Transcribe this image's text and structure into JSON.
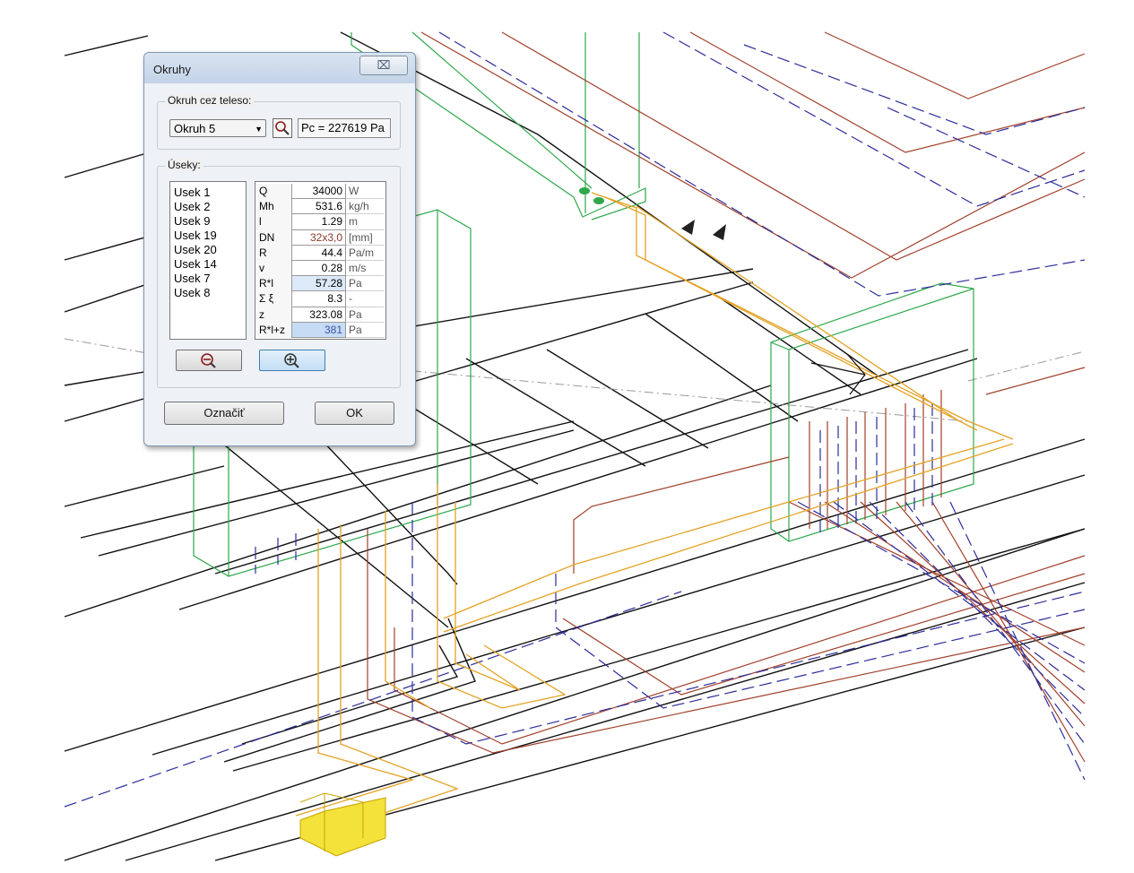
{
  "dialog": {
    "title": "Okruhy",
    "close_glyph": "⌧",
    "circuit_group_label": "Okruh cez teleso:",
    "circuit_selected": "Okruh 5",
    "pressure_text": "Pc = 227619 Pa",
    "sections_group_label": "Úseky:",
    "sections": [
      "Usek 1",
      "Usek 2",
      "Usek 9",
      "Usek 19",
      "Usek 20",
      "Usek 14",
      "Usek 7",
      "Usek 8"
    ],
    "properties": [
      {
        "name": "Q",
        "value": "34000",
        "unit": "W"
      },
      {
        "name": "Mh",
        "value": "531.6",
        "unit": "kg/h"
      },
      {
        "name": "l",
        "value": "1.29",
        "unit": "m"
      },
      {
        "name": "DN",
        "value": "32x3,0",
        "unit": "[mm]"
      },
      {
        "name": "R",
        "value": "44.4",
        "unit": "Pa/m"
      },
      {
        "name": "v",
        "value": "0.28",
        "unit": "m/s"
      },
      {
        "name": "R*l",
        "value": "57.28",
        "unit": "Pa"
      },
      {
        "name": "Σ ξ",
        "value": "8.3",
        "unit": "-"
      },
      {
        "name": "z",
        "value": "323.08",
        "unit": "Pa"
      },
      {
        "name": "R*l+z",
        "value": "381",
        "unit": "Pa"
      }
    ],
    "zoom_out_icon": "zoom-out-icon",
    "zoom_in_icon": "zoom-in-icon",
    "mark_button": "Označiť",
    "ok_button": "OK"
  },
  "colors": {
    "supply_pipe": "#a0402a",
    "return_pipe": "#2d2d9a",
    "distribution_pipe": "#e3a224",
    "radiator_outline": "#2ea84a",
    "structure": "#111111",
    "valve": "#f2e23a"
  }
}
